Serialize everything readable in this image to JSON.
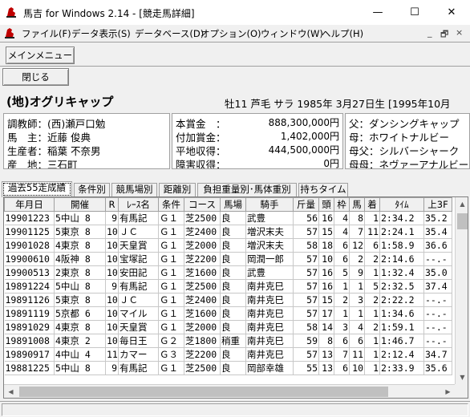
{
  "window": {
    "title": "馬吉 for Windows 2.14 - [競走馬詳細]",
    "icon": "horse-app-icon",
    "controls": {
      "minimize": "—",
      "maximize": "☐",
      "close": "✕"
    }
  },
  "menu": {
    "items": [
      "ファイル(F)",
      "データ表示(S)",
      "データベース(D)",
      "オプション(O)",
      "ウィンドウ(W)",
      "ヘルプ(H)"
    ],
    "mdi_controls": [
      "_",
      "🗗",
      "×"
    ]
  },
  "toolbar": {
    "main_menu_label": "メインメニュー",
    "close_label": "閉じる"
  },
  "horse": {
    "name": "(地)オグリキャップ",
    "attributes": "牡11 芦毛 サラ 1985年 3月27日生 [1995年10月"
  },
  "connections": {
    "trainer_label": "調教師：",
    "trainer": "(西)瀬戸口勉",
    "owner_label": "馬　主：",
    "owner": "近藤 俊典",
    "breeder_label": "生産者：",
    "breeder": "稲葉 不奈男",
    "origin_label": "産　地：",
    "origin": "三石町"
  },
  "earnings": {
    "prize_label": "本賞金　：",
    "prize": "888,300,000円",
    "additional_label": "付加賞金：",
    "additional": "1,402,000円",
    "flat_label": "平地収得：",
    "flat": "444,500,000円",
    "obstacle_label": "障害収得：",
    "obstacle": "0円"
  },
  "pedigree": {
    "sire_label": "父：",
    "sire": "ダンシングキャップ",
    "dam_label": "母：",
    "dam": "ホワイトナルビー",
    "dam_sire_label": "母父：",
    "dam_sire": "シルバーシャーク",
    "dam_dam_label": "母母：",
    "dam_dam": "ネヴァーアナルビー"
  },
  "tabs": [
    "過去55走成績",
    "条件別",
    "競馬場別",
    "距離別",
    "負担重量別･馬体重別",
    "持ちタイム"
  ],
  "active_tab": 0,
  "results": {
    "columns": [
      "年月日",
      "開催",
      "R",
      "ﾚｰｽ名",
      "条件",
      "コース",
      "馬場",
      "騎手",
      "斤量",
      "頭",
      "枠",
      "馬",
      "着",
      "ﾀｲﾑ",
      "上3F"
    ],
    "rows": [
      [
        "19901223",
        "5中山 8",
        "9",
        "有馬記",
        "Ｇ１",
        "芝2500",
        "良",
        "武豊",
        "56",
        "16",
        "4",
        "8",
        "1",
        "2:34.2",
        "35.2"
      ],
      [
        "19901125",
        "5東京 8",
        "10",
        "ＪＣ",
        "Ｇ１",
        "芝2400",
        "良",
        "増沢末夫",
        "57",
        "15",
        "4",
        "7",
        "11",
        "2:24.1",
        "35.4"
      ],
      [
        "19901028",
        "4東京 8",
        "10",
        "天皇賞",
        "Ｇ１",
        "芝2000",
        "良",
        "増沢末夫",
        "58",
        "18",
        "6",
        "12",
        "6",
        "1:58.9",
        "36.6"
      ],
      [
        "19900610",
        "4阪神 8",
        "10",
        "宝塚記",
        "Ｇ１",
        "芝2200",
        "良",
        "岡潤一郎",
        "57",
        "10",
        "6",
        "2",
        "2",
        "2:14.6",
        "--.-"
      ],
      [
        "19900513",
        "2東京 8",
        "10",
        "安田記",
        "Ｇ１",
        "芝1600",
        "良",
        "武豊",
        "57",
        "16",
        "5",
        "9",
        "1",
        "1:32.4",
        "35.0"
      ],
      [
        "19891224",
        "5中山 8",
        "9",
        "有馬記",
        "Ｇ１",
        "芝2500",
        "良",
        "南井克巳",
        "57",
        "16",
        "1",
        "1",
        "5",
        "2:32.5",
        "37.4"
      ],
      [
        "19891126",
        "5東京 8",
        "10",
        "ＪＣ",
        "Ｇ１",
        "芝2400",
        "良",
        "南井克巳",
        "57",
        "15",
        "2",
        "3",
        "2",
        "2:22.2",
        "--.-"
      ],
      [
        "19891119",
        "5京都 6",
        "10",
        "マイル",
        "Ｇ１",
        "芝1600",
        "良",
        "南井克巳",
        "57",
        "17",
        "1",
        "1",
        "1",
        "1:34.6",
        "--.-"
      ],
      [
        "19891029",
        "4東京 8",
        "10",
        "天皇賞",
        "Ｇ１",
        "芝2000",
        "良",
        "南井克巳",
        "58",
        "14",
        "3",
        "4",
        "2",
        "1:59.1",
        "--.-"
      ],
      [
        "19891008",
        "4東京 2",
        "10",
        "毎日王",
        "Ｇ２",
        "芝1800",
        "稍重",
        "南井克巳",
        "59",
        "8",
        "6",
        "6",
        "1",
        "1:46.7",
        "--.-"
      ],
      [
        "19890917",
        "4中山 4",
        "11",
        "カマー",
        "Ｇ３",
        "芝2200",
        "良",
        "南井克巳",
        "57",
        "13",
        "7",
        "11",
        "1",
        "2:12.4",
        "34.7"
      ],
      [
        "19881225",
        "5中山 8",
        "9",
        "有馬記",
        "Ｇ１",
        "芝2500",
        "良",
        "岡部幸雄",
        "55",
        "13",
        "6",
        "10",
        "1",
        "2:33.9",
        "35.6"
      ]
    ]
  }
}
